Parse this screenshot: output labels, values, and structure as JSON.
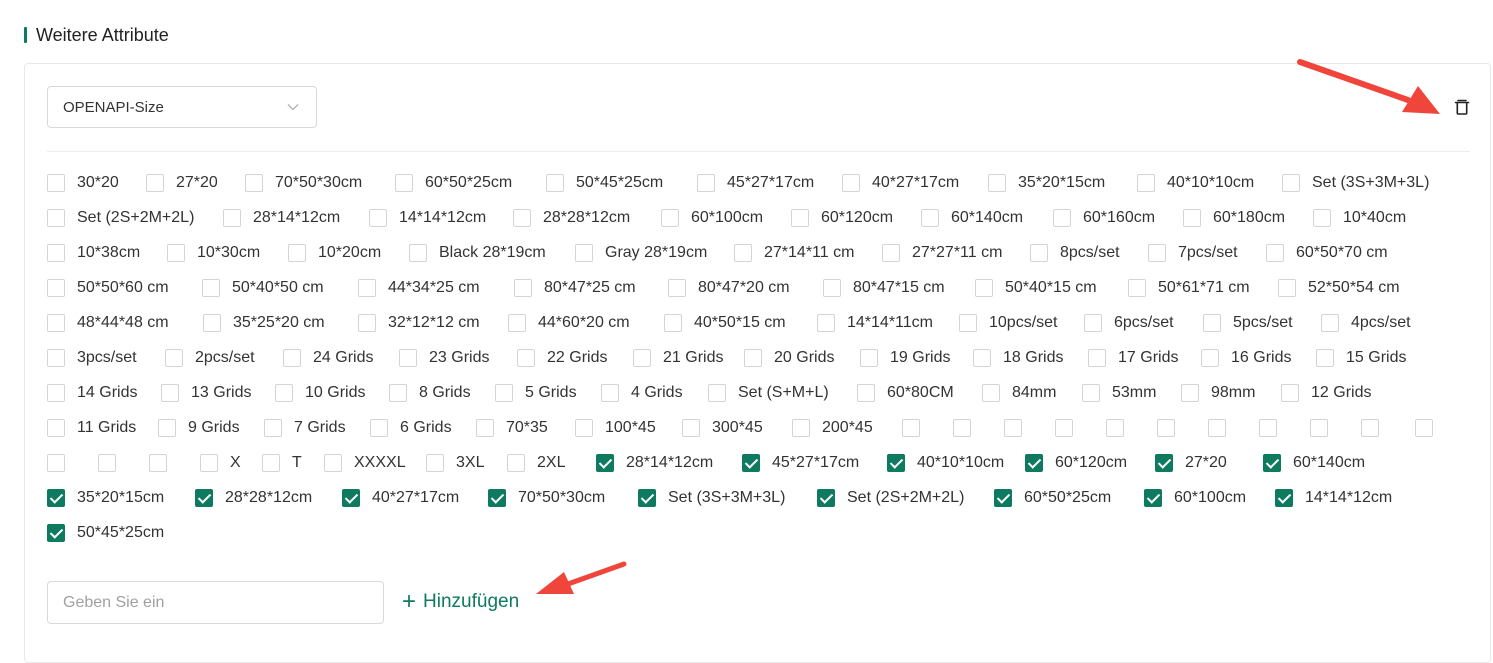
{
  "section": {
    "title": "Weitere Attribute"
  },
  "attribute_select": {
    "value": "OPENAPI-Size",
    "icon": "chevron-down-icon"
  },
  "delete_icon": "trash-icon",
  "options": [
    [
      {
        "label": "30*20",
        "checked": false
      },
      {
        "label": "27*20",
        "checked": false
      },
      {
        "label": "70*50*30cm",
        "checked": false
      },
      {
        "label": "60*50*25cm",
        "checked": false
      },
      {
        "label": "50*45*25cm",
        "checked": false
      },
      {
        "label": "45*27*17cm",
        "checked": false
      },
      {
        "label": "40*27*17cm",
        "checked": false
      },
      {
        "label": "35*20*15cm",
        "checked": false
      },
      {
        "label": "40*10*10cm",
        "checked": false
      },
      {
        "label": "Set (3S+3M+3L)",
        "checked": false
      }
    ],
    [
      {
        "label": "Set (2S+2M+2L)",
        "checked": false
      },
      {
        "label": "28*14*12cm",
        "checked": false
      },
      {
        "label": "14*14*12cm",
        "checked": false
      },
      {
        "label": "28*28*12cm",
        "checked": false
      },
      {
        "label": "60*100cm",
        "checked": false
      },
      {
        "label": "60*120cm",
        "checked": false
      },
      {
        "label": "60*140cm",
        "checked": false
      },
      {
        "label": "60*160cm",
        "checked": false
      },
      {
        "label": "60*180cm",
        "checked": false
      },
      {
        "label": "10*40cm",
        "checked": false
      }
    ],
    [
      {
        "label": "10*38cm",
        "checked": false
      },
      {
        "label": "10*30cm",
        "checked": false
      },
      {
        "label": "10*20cm",
        "checked": false
      },
      {
        "label": "Black 28*19cm",
        "checked": false
      },
      {
        "label": "Gray 28*19cm",
        "checked": false
      },
      {
        "label": "27*14*11 cm",
        "checked": false
      },
      {
        "label": "27*27*11 cm",
        "checked": false
      },
      {
        "label": "8pcs/set",
        "checked": false
      },
      {
        "label": "7pcs/set",
        "checked": false
      },
      {
        "label": "60*50*70 cm",
        "checked": false
      }
    ],
    [
      {
        "label": "50*50*60 cm",
        "checked": false
      },
      {
        "label": "50*40*50 cm",
        "checked": false
      },
      {
        "label": "44*34*25 cm",
        "checked": false
      },
      {
        "label": "80*47*25 cm",
        "checked": false
      },
      {
        "label": "80*47*20 cm",
        "checked": false
      },
      {
        "label": "80*47*15 cm",
        "checked": false
      },
      {
        "label": "50*40*15 cm",
        "checked": false
      },
      {
        "label": "50*61*71 cm",
        "checked": false
      },
      {
        "label": "52*50*54 cm",
        "checked": false
      }
    ],
    [
      {
        "label": "48*44*48 cm",
        "checked": false
      },
      {
        "label": "35*25*20 cm",
        "checked": false
      },
      {
        "label": "32*12*12 cm",
        "checked": false
      },
      {
        "label": "44*60*20 cm",
        "checked": false
      },
      {
        "label": "40*50*15 cm",
        "checked": false
      },
      {
        "label": "14*14*11cm",
        "checked": false
      },
      {
        "label": "10pcs/set",
        "checked": false
      },
      {
        "label": "6pcs/set",
        "checked": false
      },
      {
        "label": "5pcs/set",
        "checked": false
      },
      {
        "label": "4pcs/set",
        "checked": false
      }
    ],
    [
      {
        "label": "3pcs/set",
        "checked": false
      },
      {
        "label": "2pcs/set",
        "checked": false
      },
      {
        "label": "24 Grids",
        "checked": false
      },
      {
        "label": "23 Grids",
        "checked": false
      },
      {
        "label": "22 Grids",
        "checked": false
      },
      {
        "label": "21 Grids",
        "checked": false
      },
      {
        "label": "20 Grids",
        "checked": false
      },
      {
        "label": "19 Grids",
        "checked": false
      },
      {
        "label": "18 Grids",
        "checked": false
      },
      {
        "label": "17 Grids",
        "checked": false
      },
      {
        "label": "16 Grids",
        "checked": false
      },
      {
        "label": "15 Grids",
        "checked": false
      }
    ],
    [
      {
        "label": "14 Grids",
        "checked": false
      },
      {
        "label": "13 Grids",
        "checked": false
      },
      {
        "label": "10 Grids",
        "checked": false
      },
      {
        "label": "8 Grids",
        "checked": false
      },
      {
        "label": "5 Grids",
        "checked": false
      },
      {
        "label": "4 Grids",
        "checked": false
      },
      {
        "label": "Set (S+M+L)",
        "checked": false
      },
      {
        "label": "60*80CM",
        "checked": false
      },
      {
        "label": "84mm",
        "checked": false
      },
      {
        "label": "53mm",
        "checked": false
      },
      {
        "label": "98mm",
        "checked": false
      },
      {
        "label": "12 Grids",
        "checked": false
      }
    ],
    [
      {
        "label": "11 Grids",
        "checked": false
      },
      {
        "label": "9 Grids",
        "checked": false
      },
      {
        "label": "7 Grids",
        "checked": false
      },
      {
        "label": "6 Grids",
        "checked": false
      },
      {
        "label": "70*35",
        "checked": false
      },
      {
        "label": "100*45",
        "checked": false
      },
      {
        "label": "300*45",
        "checked": false
      },
      {
        "label": "200*45",
        "checked": false
      },
      {
        "label": "",
        "checked": false
      },
      {
        "label": "",
        "checked": false
      },
      {
        "label": "",
        "checked": false
      },
      {
        "label": "",
        "checked": false
      },
      {
        "label": "",
        "checked": false
      },
      {
        "label": "",
        "checked": false
      },
      {
        "label": "",
        "checked": false
      },
      {
        "label": "",
        "checked": false
      },
      {
        "label": "",
        "checked": false
      },
      {
        "label": "",
        "checked": false
      },
      {
        "label": "",
        "checked": false
      }
    ],
    [
      {
        "label": "",
        "checked": false
      },
      {
        "label": "",
        "checked": false
      },
      {
        "label": "",
        "checked": false
      },
      {
        "label": "X",
        "checked": false
      },
      {
        "label": "T",
        "checked": false
      },
      {
        "label": "XXXXL",
        "checked": false
      },
      {
        "label": "3XL",
        "checked": false
      },
      {
        "label": "2XL",
        "checked": false
      },
      {
        "label": "28*14*12cm",
        "checked": true
      },
      {
        "label": "45*27*17cm",
        "checked": true
      },
      {
        "label": "40*10*10cm",
        "checked": true
      },
      {
        "label": "60*120cm",
        "checked": true
      },
      {
        "label": "27*20",
        "checked": true
      },
      {
        "label": "60*140cm",
        "checked": true
      }
    ],
    [
      {
        "label": "35*20*15cm",
        "checked": true
      },
      {
        "label": "28*28*12cm",
        "checked": true
      },
      {
        "label": "40*27*17cm",
        "checked": true
      },
      {
        "label": "70*50*30cm",
        "checked": true
      },
      {
        "label": "Set (3S+3M+3L)",
        "checked": true
      },
      {
        "label": "Set (2S+2M+2L)",
        "checked": true
      },
      {
        "label": "60*50*25cm",
        "checked": true
      },
      {
        "label": "60*100cm",
        "checked": true
      },
      {
        "label": "14*14*12cm",
        "checked": true
      }
    ],
    [
      {
        "label": "50*45*25cm",
        "checked": true
      }
    ]
  ],
  "new_value_input": {
    "placeholder": "Geben Sie ein",
    "value": ""
  },
  "add_button": {
    "label": "Hinzufügen",
    "icon": "plus-icon"
  },
  "colors": {
    "accent": "#0e7a5f",
    "annotation_arrow": "#f0453a"
  }
}
